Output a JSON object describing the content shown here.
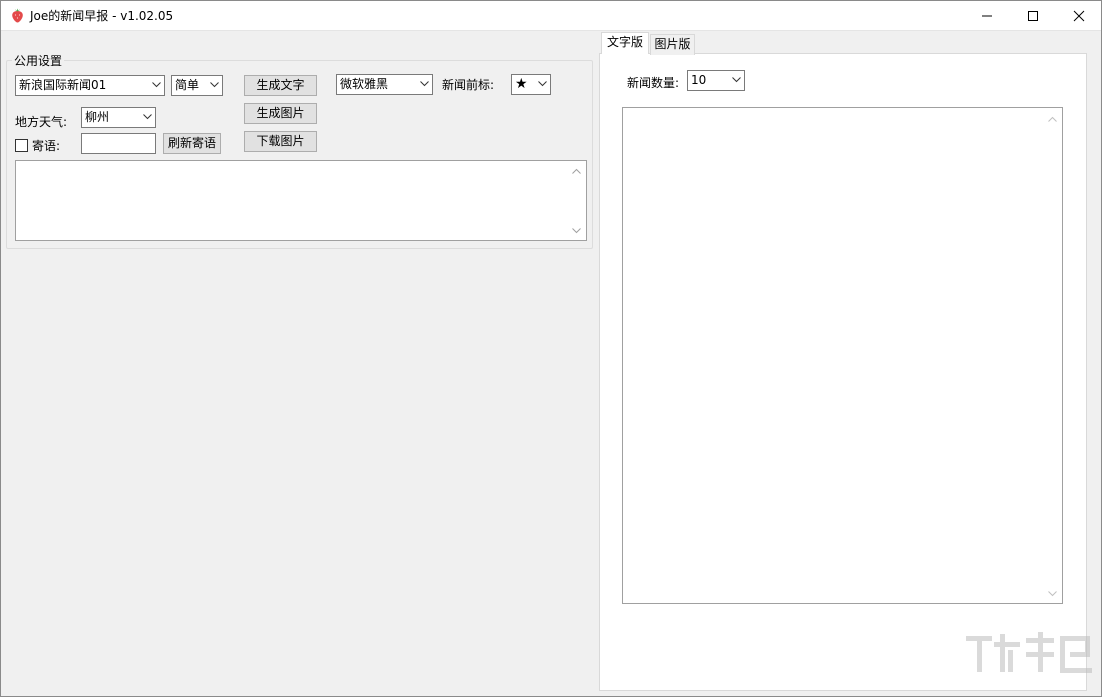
{
  "window": {
    "title": "Joe的新闻早报 - v1.02.05",
    "controls": {
      "minimize": "minimize",
      "maximize": "maximize",
      "close": "close"
    }
  },
  "public_settings": {
    "group_label": "公用设置",
    "news_source": {
      "value": "新浪国际新闻01"
    },
    "script_style": {
      "value": "简单"
    },
    "weather_label": "地方天气:",
    "weather_city": {
      "value": "柳州"
    },
    "message_checkbox": {
      "label": "寄语:",
      "checked": false
    },
    "message_input": {
      "value": ""
    },
    "refresh_message_button": "刷新寄语",
    "generate_text_button": "生成文字",
    "generate_image_button": "生成图片",
    "download_image_button": "下载图片",
    "font_select": {
      "value": "微软雅黑"
    },
    "news_prefix_label": "新闻前标:",
    "news_prefix_select": {
      "value": "★"
    },
    "output_textarea": {
      "value": ""
    }
  },
  "tabs": [
    {
      "label": "文字版",
      "active": true
    },
    {
      "label": "图片版",
      "active": false
    }
  ],
  "text_tab": {
    "news_count_label": "新闻数量:",
    "news_count_select": {
      "value": "10"
    },
    "content_textarea": {
      "value": ""
    }
  },
  "icons": {
    "app": "strawberry-icon",
    "dropdown": "chevron-down-icon",
    "scroll_up": "chevron-up-icon",
    "scroll_down": "chevron-down-icon"
  },
  "colors": {
    "window_bg": "#f0f0f0",
    "titlebar_bg": "#ffffff",
    "button_bg": "#e1e1e1",
    "button_border": "#adadad",
    "input_border": "#7a7a7a",
    "app_icon": "#e34a4a"
  }
}
